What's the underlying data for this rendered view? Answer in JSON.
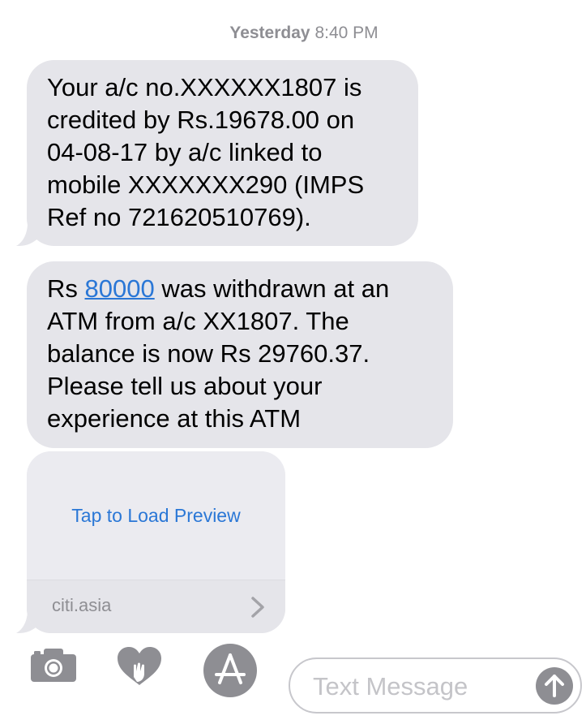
{
  "timestamp": {
    "day": "Yesterday",
    "time": "8:40 PM"
  },
  "messages": [
    {
      "text": "Your a/c no.XXXXXX1807 is\ncredited by Rs.19678.00 on\n04-08-17 by a/c linked to\nmobile XXXXXXX290 (IMPS\nRef no 721620510769)."
    },
    {
      "prefix": "Rs ",
      "link": "80000",
      "suffix": " was withdrawn at an\nATM from a/c XX1807. The\nbalance is now Rs 29760.37.\nPlease tell us about your\nexperience at this ATM"
    }
  ],
  "preview": {
    "load_label": "Tap to Load Preview",
    "domain": "citi.asia"
  },
  "input": {
    "placeholder": "Text Message"
  },
  "icons": {
    "camera": "camera-icon",
    "digital_touch": "digital-touch-icon",
    "appstore": "app-store-icon",
    "send": "send-arrow-icon",
    "chevron": "chevron-right-icon"
  },
  "colors": {
    "bubble": "#e5e5ea",
    "link": "#2a77d6",
    "meta": "#8e8e93",
    "icon": "#8e8e93"
  }
}
